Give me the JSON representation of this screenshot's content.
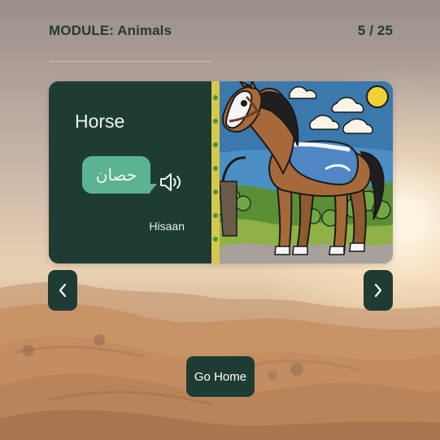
{
  "module": {
    "title": "MODULE: Animals"
  },
  "progress": {
    "current": 5,
    "total": 25,
    "label": "5 / 25"
  },
  "card": {
    "english_word": "Horse",
    "arabic_word": "حصان",
    "transliteration": "Hisaan",
    "image_subject": "horse-illustration",
    "speaker_icon": "speaker-icon"
  },
  "navigation": {
    "prev_icon": "chevron-left-icon",
    "next_icon": "chevron-right-icon",
    "home_label": "Go Home"
  },
  "colors": {
    "card_background": "#1f3c34",
    "bubble": "#5bb391",
    "text_dark": "#243b33"
  }
}
